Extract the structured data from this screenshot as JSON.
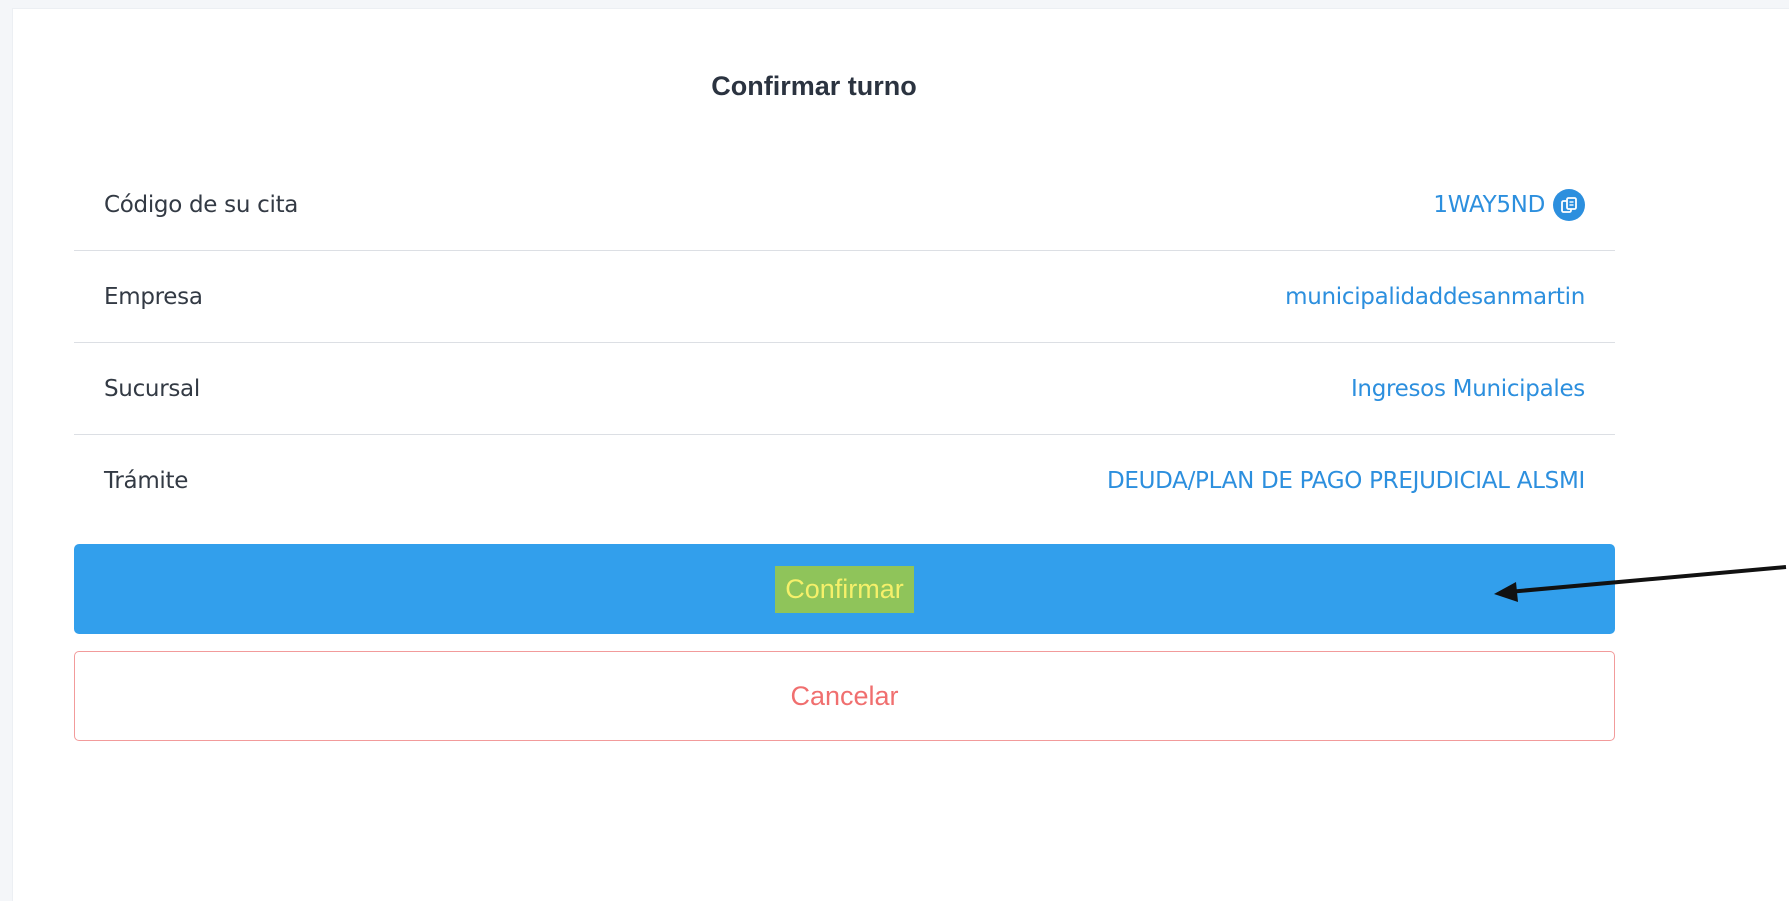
{
  "dialog": {
    "title": "Confirmar turno"
  },
  "details": [
    {
      "label": "Código de su cita",
      "value": "1WAY5ND",
      "has_copy_icon": true
    },
    {
      "label": "Empresa",
      "value": "municipalidaddesanmartin"
    },
    {
      "label": "Sucursal",
      "value": "Ingresos Municipales"
    },
    {
      "label": "Trámite",
      "value": "DEUDA/PLAN DE PAGO PREJUDICIAL ALSMI"
    }
  ],
  "actions": {
    "confirm_label": "Confirmar",
    "cancel_label": "Cancelar"
  },
  "icons": {
    "copy": "copy-icon",
    "annotation_arrow": "arrow-icon"
  },
  "colors": {
    "primary": "#329fec",
    "value_text": "#2c8fde",
    "cancel": "#f06f6f",
    "highlight_bg": "#8fc45a",
    "highlight_text": "#f5f06a"
  }
}
